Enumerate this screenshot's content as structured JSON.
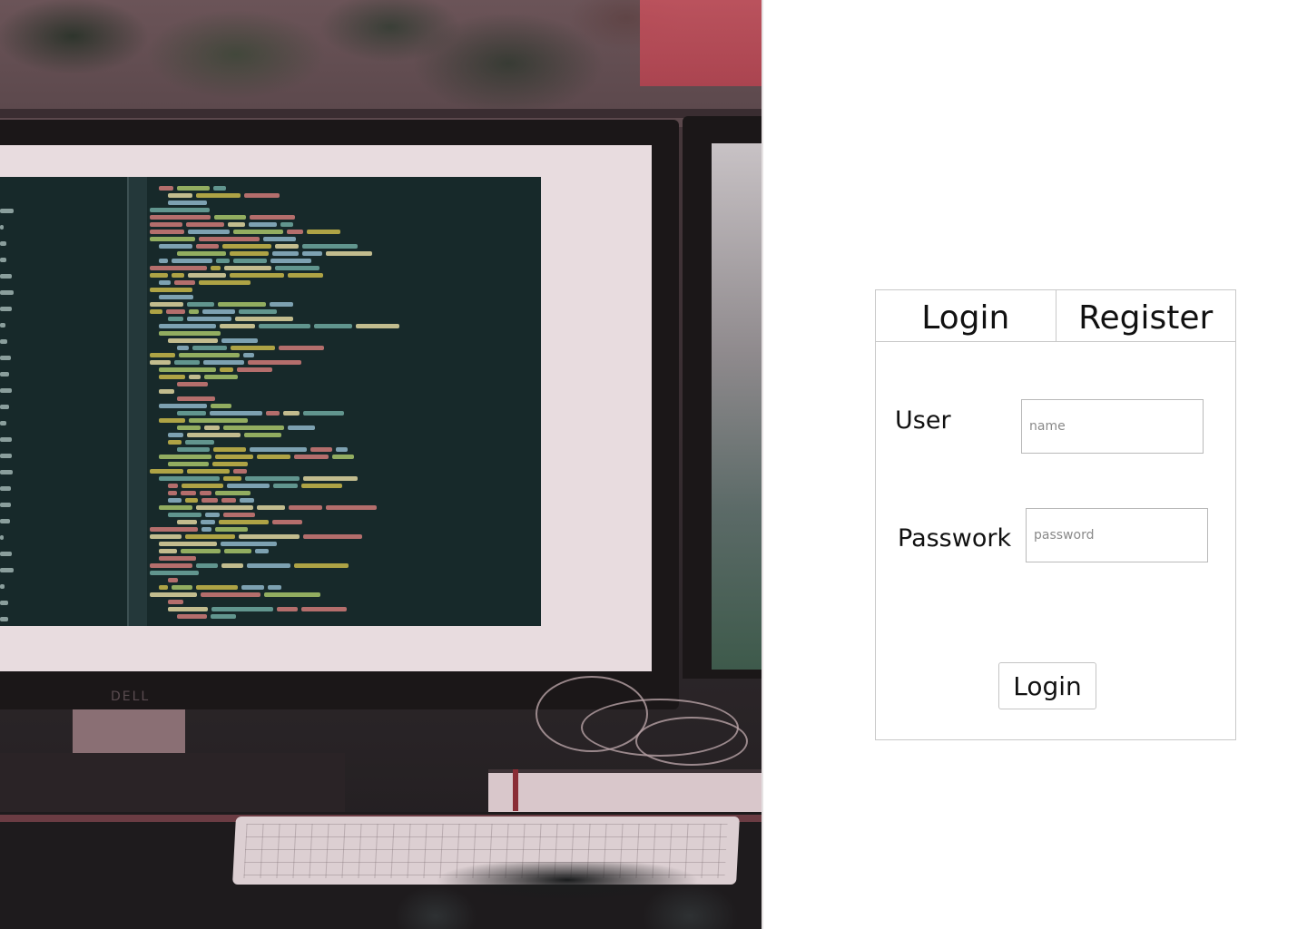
{
  "hero": {
    "image_description_icon": "desk-monitor-code-photo",
    "monitor_brand": "DELL"
  },
  "auth": {
    "tabs": [
      {
        "label": "Login"
      },
      {
        "label": "Register"
      }
    ],
    "user_label": "User",
    "user_placeholder": "name",
    "user_value": "",
    "password_label": "Passwork",
    "password_placeholder": "password",
    "password_value": "",
    "submit_label": "Login"
  },
  "colors": {
    "panel_border": "#c9c9c9",
    "text": "#111111",
    "background": "#ffffff"
  }
}
